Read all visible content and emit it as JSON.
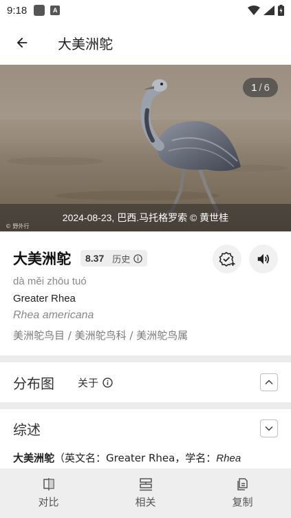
{
  "status_bar": {
    "time": "9:18",
    "a_glyph": "A"
  },
  "app_bar": {
    "title": "大美洲鸵"
  },
  "hero": {
    "counter_current": "1",
    "counter_sep": "/",
    "counter_total": "6",
    "caption": "2024-08-23, 巴西.马托格罗索 © 黄世桂",
    "watermark": "© 野外行"
  },
  "species": {
    "cn_name": "大美洲鸵",
    "score": "8.37",
    "history_label": "历史",
    "pinyin": "dà měi zhōu tuó",
    "english_name": "Greater Rhea",
    "latin_name": "Rhea americana",
    "taxonomy": "美洲鸵鸟目 / 美洲鸵鸟科 / 美洲鸵鸟属"
  },
  "distribution": {
    "title": "分布图",
    "about_label": "关于"
  },
  "summary": {
    "title": "综述",
    "name_bold": "大美洲鸵",
    "text_mid": "（英文名：Greater Rhea，学名：",
    "latin_italic": "Rhea"
  },
  "bottom_nav": [
    {
      "label": "对比",
      "icon": "compare-icon"
    },
    {
      "label": "相关",
      "icon": "related-icon"
    },
    {
      "label": "复制",
      "icon": "copy-icon"
    }
  ],
  "colors": {
    "divider": "#ececec",
    "bottom_bar": "#eeeeee",
    "chip": "#eeeeee"
  }
}
